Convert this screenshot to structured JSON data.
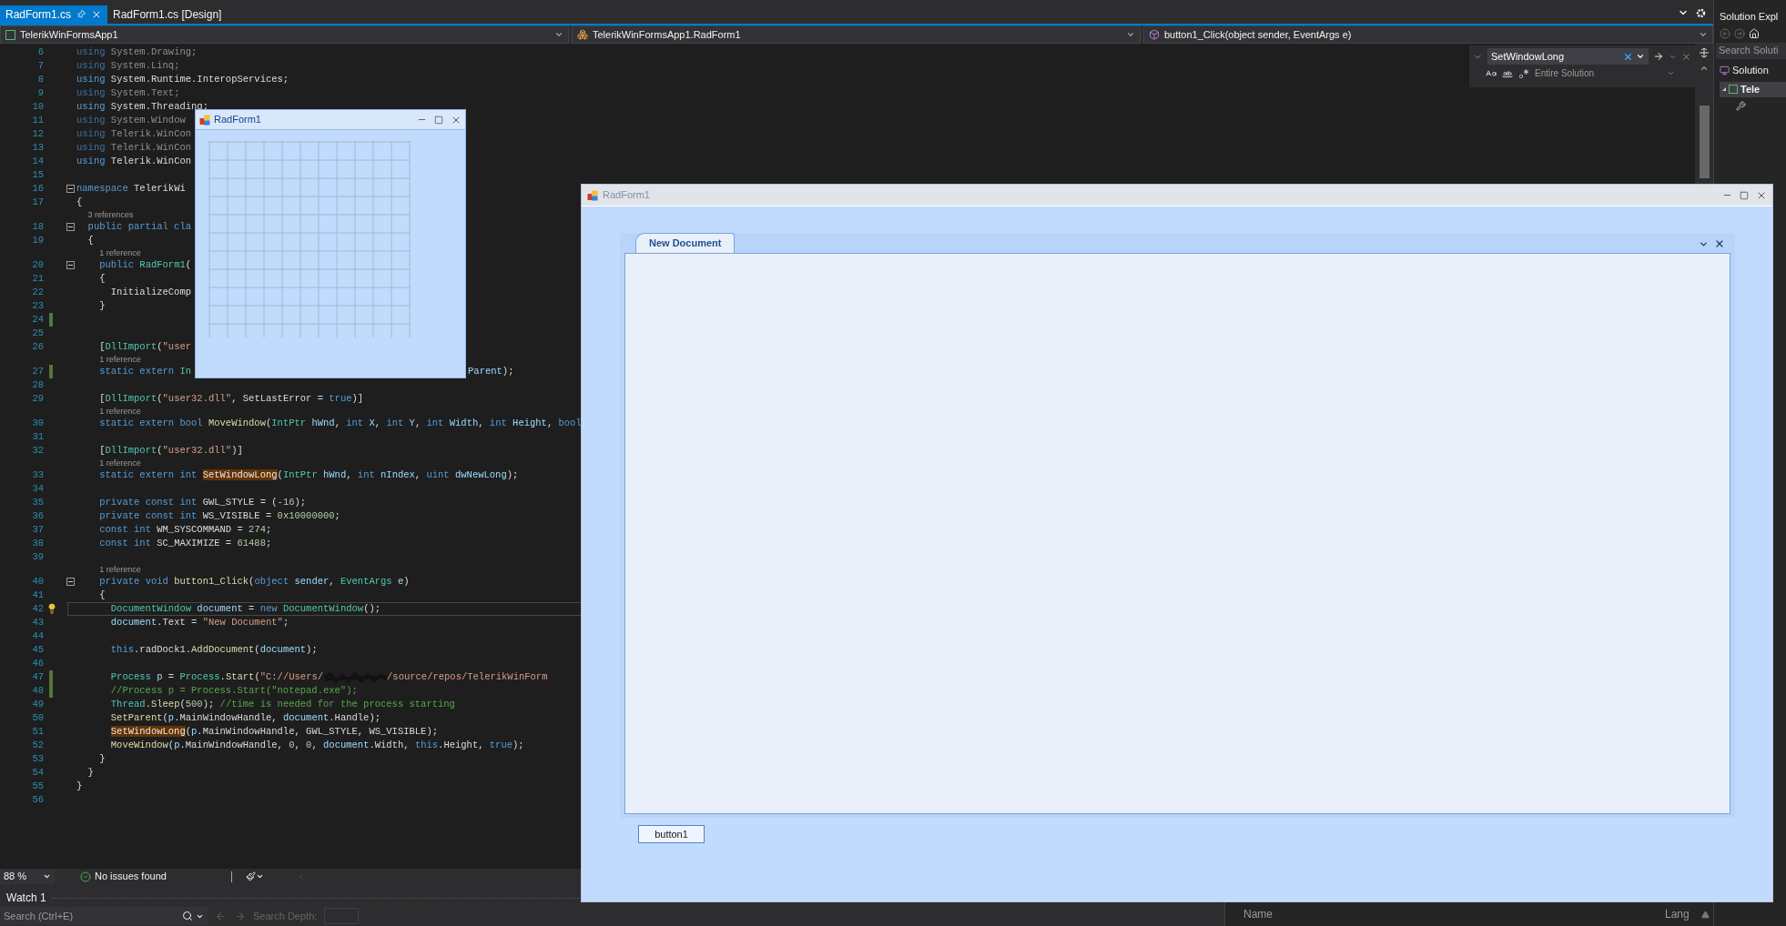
{
  "tabs": [
    {
      "label": "RadForm1.cs",
      "selected": true,
      "pinned": true
    },
    {
      "label": "RadForm1.cs [Design]",
      "selected": false,
      "pinned": false
    }
  ],
  "navigation": [
    {
      "kind": "project",
      "label": "TelerikWinFormsApp1"
    },
    {
      "kind": "class",
      "label": "TelerikWinFormsApp1.RadForm1"
    },
    {
      "kind": "method",
      "label": "button1_Click(object sender, EventArgs e)"
    }
  ],
  "find": {
    "value": "SetWindowLong",
    "scope": "Entire Solution"
  },
  "code_lines": [
    {
      "number": "6",
      "tokens": [
        {
          "text": "using",
          "kind": "fadedkw"
        },
        {
          "text": " System.Drawing;",
          "kind": "faded"
        }
      ]
    },
    {
      "number": "7",
      "tokens": [
        {
          "text": "using",
          "kind": "fadedkw"
        },
        {
          "text": " System.Linq;",
          "kind": "faded"
        }
      ]
    },
    {
      "number": "8",
      "tokens": [
        {
          "text": "using",
          "kind": "keyword"
        },
        {
          "text": " System.Runtime.InteropServices;",
          "kind": "plain"
        }
      ]
    },
    {
      "number": "9",
      "tokens": [
        {
          "text": "using",
          "kind": "fadedkw"
        },
        {
          "text": " System.Text;",
          "kind": "faded"
        }
      ]
    },
    {
      "number": "10",
      "tokens": [
        {
          "text": "using",
          "kind": "keyword"
        },
        {
          "text": " System.Threading;",
          "kind": "plain"
        }
      ]
    },
    {
      "number": "11",
      "tokens": [
        {
          "text": "using",
          "kind": "fadedkw"
        },
        {
          "text": " System.Window",
          "kind": "faded"
        }
      ]
    },
    {
      "number": "12",
      "tokens": [
        {
          "text": "using",
          "kind": "fadedkw"
        },
        {
          "text": " Telerik.WinCon",
          "kind": "faded"
        }
      ]
    },
    {
      "number": "13",
      "tokens": [
        {
          "text": "using",
          "kind": "fadedkw"
        },
        {
          "text": " Telerik.WinCon",
          "kind": "faded"
        }
      ]
    },
    {
      "number": "14",
      "tokens": [
        {
          "text": "using",
          "kind": "keyword"
        },
        {
          "text": " Telerik.WinCon",
          "kind": "plain"
        }
      ]
    },
    {
      "number": "15"
    },
    {
      "number": "16",
      "fold": true,
      "tokens": [
        {
          "text": "namespace",
          "kind": "keyword"
        },
        {
          "text": " TelerikWi",
          "kind": "plain"
        }
      ]
    },
    {
      "number": "17",
      "tokens": [
        {
          "text": "{",
          "kind": "plain"
        }
      ]
    },
    {
      "number": "18",
      "lens": "3 references",
      "fold": true,
      "tokens": [
        {
          "text": "  public partial cla",
          "kind": "keyword"
        }
      ]
    },
    {
      "number": "19",
      "tokens": [
        {
          "text": "  {",
          "kind": "plain"
        }
      ]
    },
    {
      "number": "20",
      "lens": "1 reference",
      "fold": true,
      "tokens": [
        {
          "text": "    public ",
          "kind": "keyword"
        },
        {
          "text": "RadForm1",
          "kind": "type"
        },
        {
          "text": "(",
          "kind": "plain"
        }
      ]
    },
    {
      "number": "21",
      "tokens": [
        {
          "text": "    {",
          "kind": "plain"
        }
      ]
    },
    {
      "number": "22",
      "tokens": [
        {
          "text": "      InitializeComp",
          "kind": "plain"
        }
      ]
    },
    {
      "number": "23",
      "tokens": [
        {
          "text": "    }",
          "kind": "plain"
        }
      ]
    },
    {
      "number": "24",
      "changed": true
    },
    {
      "number": "25"
    },
    {
      "number": "26",
      "tokens": [
        {
          "text": "    [",
          "kind": "plain"
        },
        {
          "text": "DllImport",
          "kind": "type"
        },
        {
          "text": "(",
          "kind": "plain"
        },
        {
          "text": "\"user",
          "kind": "string"
        }
      ]
    },
    {
      "number": "27",
      "lens": "1 reference",
      "changed": true,
      "tokens": [
        {
          "text": "    static extern ",
          "kind": "keyword"
        },
        {
          "text": "In",
          "kind": "type"
        },
        {
          "kind": "gap"
        },
        {
          "text": "Parent",
          "kind": "param"
        },
        {
          "text": ");",
          "kind": "plain"
        }
      ]
    },
    {
      "number": "28"
    },
    {
      "number": "29",
      "tokens": [
        {
          "text": "    [",
          "kind": "plain"
        },
        {
          "text": "DllImport",
          "kind": "type"
        },
        {
          "text": "(",
          "kind": "plain"
        },
        {
          "text": "\"user32.dll\"",
          "kind": "string"
        },
        {
          "text": ", SetLastError = ",
          "kind": "plain"
        },
        {
          "text": "true",
          "kind": "keyword"
        },
        {
          "text": ")]",
          "kind": "plain"
        }
      ]
    },
    {
      "number": "30",
      "lens": "1 reference",
      "tokens": [
        {
          "text": "    static extern bool ",
          "kind": "keyword"
        },
        {
          "text": "MoveWindow",
          "kind": "method"
        },
        {
          "text": "(",
          "kind": "plain"
        },
        {
          "text": "IntPtr",
          "kind": "type"
        },
        {
          "text": " hWnd",
          "kind": "param"
        },
        {
          "text": ", ",
          "kind": "plain"
        },
        {
          "text": "int",
          "kind": "keyword"
        },
        {
          "text": " X",
          "kind": "param"
        },
        {
          "text": ", ",
          "kind": "plain"
        },
        {
          "text": "int",
          "kind": "keyword"
        },
        {
          "text": " Y",
          "kind": "param"
        },
        {
          "text": ", ",
          "kind": "plain"
        },
        {
          "text": "int",
          "kind": "keyword"
        },
        {
          "text": " Width",
          "kind": "param"
        },
        {
          "text": ", ",
          "kind": "plain"
        },
        {
          "text": "int",
          "kind": "keyword"
        },
        {
          "text": " Height",
          "kind": "param"
        },
        {
          "text": ", ",
          "kind": "plain"
        },
        {
          "text": "bool",
          "kind": "keyword"
        }
      ]
    },
    {
      "number": "31"
    },
    {
      "number": "32",
      "tokens": [
        {
          "text": "    [",
          "kind": "plain"
        },
        {
          "text": "DllImport",
          "kind": "type"
        },
        {
          "text": "(",
          "kind": "plain"
        },
        {
          "text": "\"user32.dll\"",
          "kind": "string"
        },
        {
          "text": ")]",
          "kind": "plain"
        }
      ]
    },
    {
      "number": "33",
      "lens": "1 reference",
      "tokens": [
        {
          "text": "    static extern int ",
          "kind": "keyword"
        },
        {
          "text": "SetWindowLong",
          "kind": "match"
        },
        {
          "text": "(",
          "kind": "plain"
        },
        {
          "text": "IntPtr",
          "kind": "type"
        },
        {
          "text": " hWnd",
          "kind": "param"
        },
        {
          "text": ", ",
          "kind": "plain"
        },
        {
          "text": "int",
          "kind": "keyword"
        },
        {
          "text": " nIndex",
          "kind": "param"
        },
        {
          "text": ", ",
          "kind": "plain"
        },
        {
          "text": "uint",
          "kind": "keyword"
        },
        {
          "text": " dwNewLong",
          "kind": "param"
        },
        {
          "text": ");",
          "kind": "plain"
        }
      ]
    },
    {
      "number": "34"
    },
    {
      "number": "35",
      "tokens": [
        {
          "text": "    private const int",
          "kind": "keyword"
        },
        {
          "text": " GWL_STYLE = (",
          "kind": "plain"
        },
        {
          "text": "-16",
          "kind": "number"
        },
        {
          "text": ");",
          "kind": "plain"
        }
      ]
    },
    {
      "number": "36",
      "tokens": [
        {
          "text": "    private const int",
          "kind": "keyword"
        },
        {
          "text": " WS_VISIBLE = ",
          "kind": "plain"
        },
        {
          "text": "0x10000000",
          "kind": "number"
        },
        {
          "text": ";",
          "kind": "plain"
        }
      ]
    },
    {
      "number": "37",
      "tokens": [
        {
          "text": "    const int",
          "kind": "keyword"
        },
        {
          "text": " WM_SYSCOMMAND = ",
          "kind": "plain"
        },
        {
          "text": "274",
          "kind": "number"
        },
        {
          "text": ";",
          "kind": "plain"
        }
      ]
    },
    {
      "number": "38",
      "tokens": [
        {
          "text": "    const int",
          "kind": "keyword"
        },
        {
          "text": " SC_MAXIMIZE = ",
          "kind": "plain"
        },
        {
          "text": "61488",
          "kind": "number"
        },
        {
          "text": ";",
          "kind": "plain"
        }
      ]
    },
    {
      "number": "39"
    },
    {
      "number": "40",
      "lens": "1 reference",
      "fold": true,
      "tokens": [
        {
          "text": "    private void ",
          "kind": "keyword"
        },
        {
          "text": "button1_Click",
          "kind": "method"
        },
        {
          "text": "(",
          "kind": "plain"
        },
        {
          "text": "object",
          "kind": "keyword"
        },
        {
          "text": " sender",
          "kind": "param"
        },
        {
          "text": ", ",
          "kind": "plain"
        },
        {
          "text": "EventArgs",
          "kind": "type"
        },
        {
          "text": " e",
          "kind": "param"
        },
        {
          "text": ")",
          "kind": "plain"
        }
      ]
    },
    {
      "number": "41",
      "tokens": [
        {
          "text": "    {",
          "kind": "plain"
        }
      ]
    },
    {
      "number": "42",
      "bulb": true,
      "current": true,
      "tokens": [
        {
          "text": "      DocumentWindow",
          "kind": "type"
        },
        {
          "text": " document",
          "kind": "param"
        },
        {
          "text": " = ",
          "kind": "plain"
        },
        {
          "text": "new",
          "kind": "keyword"
        },
        {
          "text": " DocumentWindow",
          "kind": "type"
        },
        {
          "text": "();",
          "kind": "plain"
        }
      ]
    },
    {
      "number": "43",
      "tokens": [
        {
          "text": "      document",
          "kind": "param"
        },
        {
          "text": ".Text = ",
          "kind": "plain"
        },
        {
          "text": "\"New Document\"",
          "kind": "string"
        },
        {
          "text": ";",
          "kind": "plain"
        }
      ]
    },
    {
      "number": "44"
    },
    {
      "number": "45",
      "tokens": [
        {
          "text": "      this",
          "kind": "keyword"
        },
        {
          "text": ".radDock1.",
          "kind": "plain"
        },
        {
          "text": "AddDocument",
          "kind": "method"
        },
        {
          "text": "(",
          "kind": "plain"
        },
        {
          "text": "document",
          "kind": "param"
        },
        {
          "text": ");",
          "kind": "plain"
        }
      ]
    },
    {
      "number": "46"
    },
    {
      "number": "47",
      "changed": true,
      "tokens": [
        {
          "text": "      Process",
          "kind": "type"
        },
        {
          "text": " p",
          "kind": "param"
        },
        {
          "text": " = ",
          "kind": "plain"
        },
        {
          "text": "Process",
          "kind": "type"
        },
        {
          "text": ".",
          "kind": "plain"
        },
        {
          "text": "Start",
          "kind": "method"
        },
        {
          "text": "(",
          "kind": "plain"
        },
        {
          "text": "\"C://Users/",
          "kind": "string"
        },
        {
          "kind": "redacted"
        },
        {
          "text": "/source/repos/TelerikWinForm",
          "kind": "string"
        }
      ]
    },
    {
      "number": "48",
      "changed": true,
      "tokens": [
        {
          "text": "      //Process p = Process.Start(\"notepad.exe\");",
          "kind": "comment"
        }
      ]
    },
    {
      "number": "49",
      "tokens": [
        {
          "text": "      Thread",
          "kind": "type"
        },
        {
          "text": ".",
          "kind": "plain"
        },
        {
          "text": "Sleep",
          "kind": "method"
        },
        {
          "text": "(",
          "kind": "plain"
        },
        {
          "text": "500",
          "kind": "number"
        },
        {
          "text": "); ",
          "kind": "plain"
        },
        {
          "text": "//time is needed for the process starting",
          "kind": "comment"
        }
      ]
    },
    {
      "number": "50",
      "tokens": [
        {
          "text": "      SetParent",
          "kind": "method"
        },
        {
          "text": "(",
          "kind": "plain"
        },
        {
          "text": "p",
          "kind": "param"
        },
        {
          "text": ".MainWindowHandle, ",
          "kind": "plain"
        },
        {
          "text": "document",
          "kind": "param"
        },
        {
          "text": ".Handle);",
          "kind": "plain"
        }
      ]
    },
    {
      "number": "51",
      "tokens": [
        {
          "text": "      SetWindowLong",
          "kind": "match"
        },
        {
          "text": "(",
          "kind": "plain"
        },
        {
          "text": "p",
          "kind": "param"
        },
        {
          "text": ".MainWindowHandle, GWL_STYLE, WS_VISIBLE);",
          "kind": "plain"
        }
      ]
    },
    {
      "number": "52",
      "tokens": [
        {
          "text": "      MoveWindow",
          "kind": "method"
        },
        {
          "text": "(",
          "kind": "plain"
        },
        {
          "text": "p",
          "kind": "param"
        },
        {
          "text": ".MainWindowHandle, ",
          "kind": "plain"
        },
        {
          "text": "0",
          "kind": "number"
        },
        {
          "text": ", ",
          "kind": "plain"
        },
        {
          "text": "0",
          "kind": "number"
        },
        {
          "text": ", ",
          "kind": "plain"
        },
        {
          "text": "document",
          "kind": "param"
        },
        {
          "text": ".Width, ",
          "kind": "plain"
        },
        {
          "text": "this",
          "kind": "keyword"
        },
        {
          "text": ".Height, ",
          "kind": "plain"
        },
        {
          "text": "true",
          "kind": "keyword"
        },
        {
          "text": ");",
          "kind": "plain"
        }
      ]
    },
    {
      "number": "53",
      "tokens": [
        {
          "text": "    }",
          "kind": "plain"
        }
      ]
    },
    {
      "number": "54",
      "tokens": [
        {
          "text": "  }",
          "kind": "plain"
        }
      ]
    },
    {
      "number": "55",
      "tokens": [
        {
          "text": "}",
          "kind": "plain"
        }
      ]
    },
    {
      "number": "56"
    }
  ],
  "status_bar": {
    "zoom": "88 %",
    "issues": "No issues found"
  },
  "watch": {
    "title": "Watch 1",
    "search": {
      "placeholder": "Search (Ctrl+E)"
    },
    "depth_label": "Search Depth:"
  },
  "call_stack": {
    "columns": [
      "Name",
      "Lang"
    ]
  },
  "solution_explorer": {
    "title": "Solution Expl",
    "search": {
      "placeholder": "Search Soluti"
    },
    "items": [
      {
        "label": "Solution",
        "bold": false,
        "selected": false
      },
      {
        "label": "Tele",
        "bold": true,
        "selected": true,
        "expanded": true
      }
    ]
  },
  "windows": [
    {
      "kind": "designer",
      "title": "RadForm1",
      "active": true
    },
    {
      "kind": "runtime",
      "title": "RadForm1",
      "active": false,
      "document_tab": "New Document",
      "button": "button1"
    }
  ]
}
